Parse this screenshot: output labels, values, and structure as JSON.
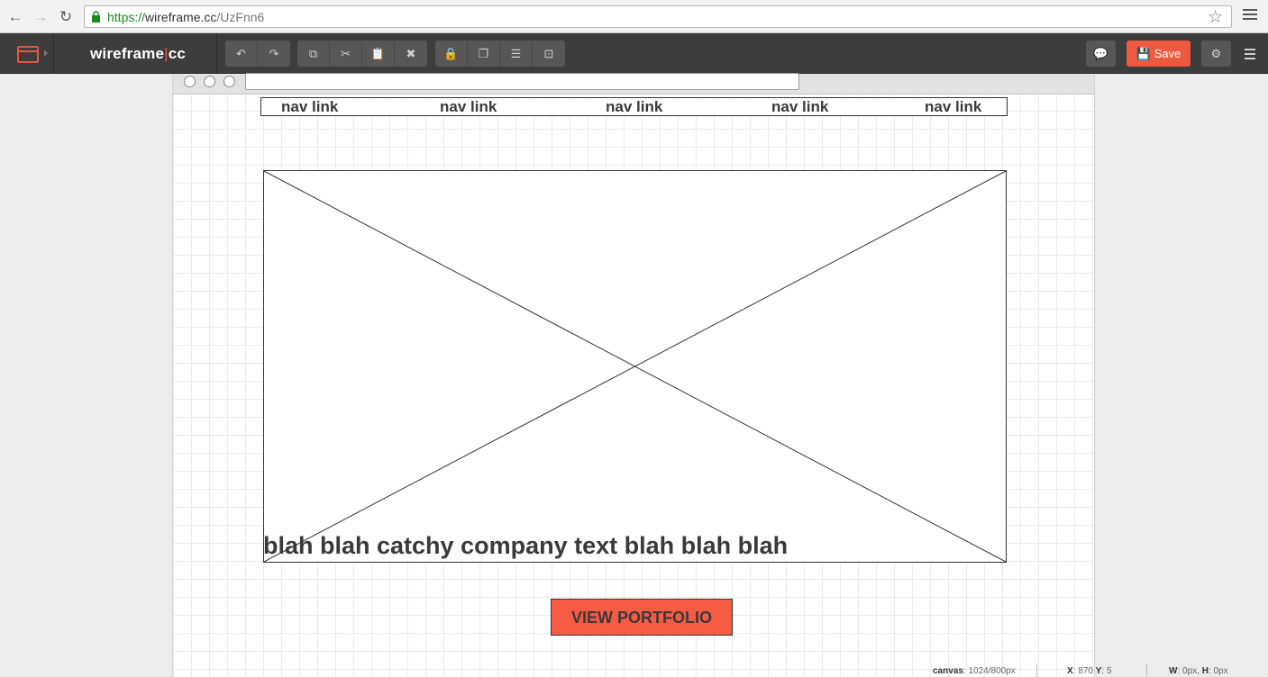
{
  "browser": {
    "url_scheme": "https://",
    "url_host": "wireframe.cc",
    "url_path": "/UzFnn6",
    "back_icon": "←",
    "forward_icon": "→",
    "reload_icon": "↻",
    "star_icon": "☆"
  },
  "app": {
    "logo_left": "wireframe",
    "logo_bar": "|",
    "logo_right": "cc",
    "save_label": "Save",
    "toolbar_icons": {
      "undo": "↶",
      "redo": "↷",
      "copy": "⧉",
      "cut": "✂",
      "paste": "📋",
      "delete": "✖",
      "lock": "🔒",
      "arrange": "❐",
      "align": "☰",
      "group": "⊡",
      "comment": "💬",
      "settings": "⚙",
      "save": "💾"
    },
    "accent_color": "#ed5a40",
    "toolbar_color": "#3d3d3d"
  },
  "wireframe": {
    "nav_links": [
      "nav link",
      "nav link",
      "nav link",
      "nav link",
      "nav link"
    ],
    "headline": "blah blah catchy company text blah blah blah",
    "cta_label": "VIEW PORTFOLIO",
    "cta_color": "#f75b43"
  },
  "status": {
    "canvas_label": "canvas",
    "canvas_value": "1024/800px",
    "x_label": "X",
    "x_value": "870",
    "y_label": "Y",
    "y_value": "5",
    "w_label": "W",
    "w_value": "0px",
    "h_label": "H",
    "h_value": "0px"
  }
}
